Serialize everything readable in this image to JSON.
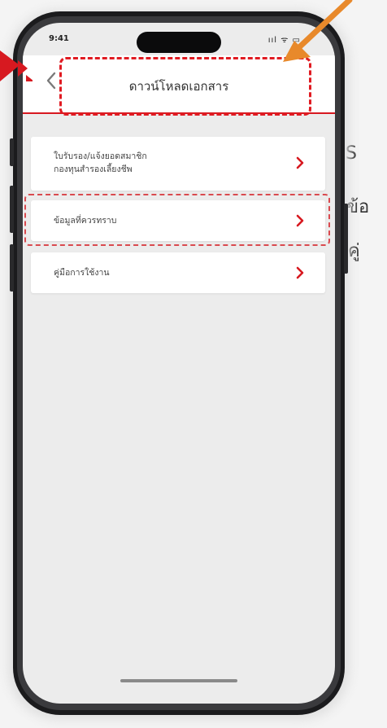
{
  "status_bar": {
    "time": "9:41",
    "icons": "ııl ᯤ ▭"
  },
  "header": {
    "back_icon": "chevron-left-icon",
    "title": "ดาวน์โหลดเอกสาร"
  },
  "menu": {
    "items": [
      {
        "label_line1": "ใบรับรอง/แจ้งยอดสมาชิก",
        "label_line2": "กองทุนสำรองเลี้ยงชีพ",
        "icon": "chevron-right-icon"
      },
      {
        "label_line1": "ข้อมูลที่ควรทราบ",
        "icon": "chevron-right-icon"
      },
      {
        "label_line1": "คู่มือการใช้งาน",
        "icon": "chevron-right-icon"
      }
    ]
  },
  "side_text": {
    "line1": "S",
    "line2": "ข้อ",
    "line3": "คู่"
  },
  "colors": {
    "accent_red": "#d71920",
    "annotation_red": "#e01b22",
    "arrow_orange": "#e8892b",
    "screen_bg": "#ececec"
  }
}
